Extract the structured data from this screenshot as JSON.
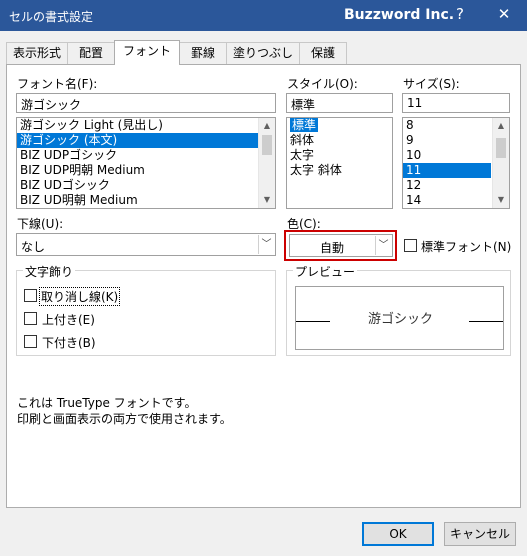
{
  "window": {
    "title": "セルの書式設定",
    "brand": "Buzzword Inc.",
    "help_glyph": "?",
    "close_glyph": "✕"
  },
  "tabs": [
    "表示形式",
    "配置",
    "フォント",
    "罫線",
    "塗りつぶし",
    "保護"
  ],
  "active_tab": "フォント",
  "font": {
    "label": "フォント名(F):",
    "value": "游ゴシック",
    "items": [
      "游ゴシック Light (見出し)",
      "游ゴシック (本文)",
      "BIZ UDPゴシック",
      "BIZ UDP明朝 Medium",
      "BIZ UDゴシック",
      "BIZ UD明朝 Medium"
    ],
    "selected_index": 1
  },
  "style": {
    "label": "スタイル(O):",
    "value": "標準",
    "items": [
      "標準",
      "斜体",
      "太字",
      "太字 斜体"
    ],
    "selected_index": 0
  },
  "size": {
    "label": "サイズ(S):",
    "value": "11",
    "items": [
      "8",
      "9",
      "10",
      "11",
      "12",
      "14"
    ],
    "selected_index": 3
  },
  "underline": {
    "label": "下線(U):",
    "value": "なし"
  },
  "color": {
    "label": "色(C):",
    "value": "自動",
    "highlight_color": "#cc0000",
    "normal_font_label": "標準フォント(N)",
    "normal_font_checked": false
  },
  "effects": {
    "legend": "文字飾り",
    "items": [
      {
        "label": "取り消し線(K)",
        "checked": false
      },
      {
        "label": "上付き(E)",
        "checked": false
      },
      {
        "label": "下付き(B)",
        "checked": false
      }
    ]
  },
  "preview": {
    "legend": "プレビュー",
    "sample": "游ゴシック"
  },
  "info": {
    "line1": "これは TrueType フォントです。",
    "line2": "印刷と画面表示の両方で使用されます。"
  },
  "buttons": {
    "ok": "OK",
    "cancel": "キャンセル"
  },
  "colors": {
    "titlebar": "#2b579a",
    "selection": "#0078d7",
    "default_button": "#0078d7"
  }
}
